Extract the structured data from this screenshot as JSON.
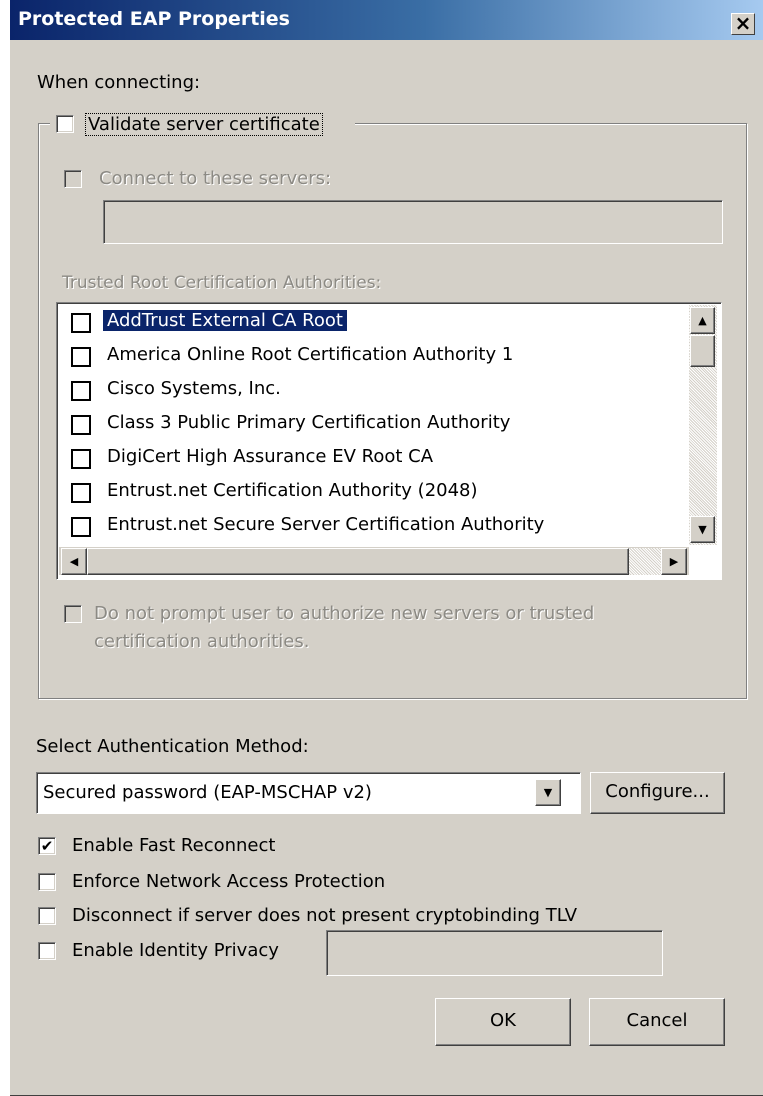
{
  "window": {
    "title": "Protected EAP Properties",
    "close_glyph": "×"
  },
  "when_connecting": "When connecting:",
  "validate": {
    "label": "Validate server certificate",
    "checked": false
  },
  "connect_servers": {
    "label": "Connect to these servers:",
    "value": ""
  },
  "trusted_root_label": "Trusted Root Certification Authorities:",
  "cert_list": [
    "AddTrust External CA Root",
    "America Online Root Certification Authority 1",
    "Cisco Systems, Inc.",
    "Class 3 Public Primary Certification Authority",
    "DigiCert High Assurance EV Root CA",
    "Entrust.net Certification Authority (2048)",
    "Entrust.net Secure Server Certification Authority"
  ],
  "selected_cert": "AddTrust External CA Root",
  "do_not_prompt": {
    "line1": "Do not prompt user to authorize new servers or trusted",
    "line2": "certification authorities."
  },
  "auth_method": {
    "label": "Select Authentication Method:",
    "selected": "Secured password (EAP-MSCHAP v2)",
    "configure_label": "Configure..."
  },
  "options": {
    "fast_reconnect": {
      "label": "Enable Fast Reconnect",
      "checked": true
    },
    "nap": {
      "label": "Enforce Network Access Protection",
      "checked": false
    },
    "cryptobinding": {
      "label": "Disconnect if server does not present cryptobinding TLV",
      "checked": false
    },
    "identity_privacy": {
      "label": "Enable Identity Privacy",
      "checked": false,
      "value": ""
    }
  },
  "buttons": {
    "ok": "OK",
    "cancel": "Cancel"
  },
  "icons": {
    "check": "✔",
    "scroll_up": "▲",
    "scroll_down": "▼",
    "scroll_left": "◀",
    "scroll_right": "▶",
    "dropdown": "▼"
  }
}
